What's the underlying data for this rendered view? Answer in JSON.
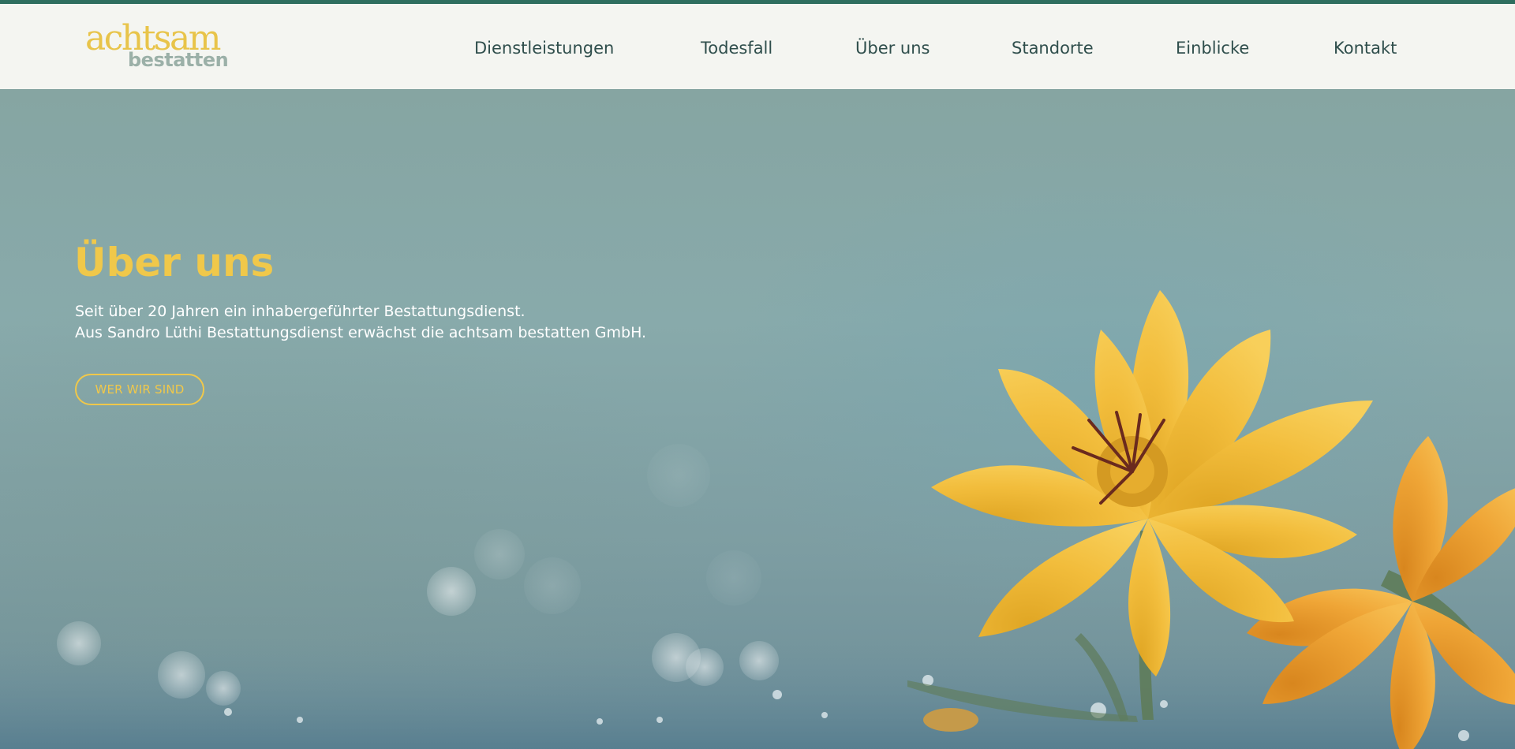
{
  "header": {
    "logo": {
      "line1": "achtsam",
      "line2": "bestatten"
    },
    "nav": [
      {
        "label": "Dienstleistungen"
      },
      {
        "label": "Todesfall"
      },
      {
        "label": "Über uns"
      },
      {
        "label": "Standorte"
      },
      {
        "label": "Einblicke"
      },
      {
        "label": "Kontakt"
      }
    ]
  },
  "hero": {
    "title": "Über uns",
    "lines": [
      "Seit über 20 Jahren ein inhabergeführter Bestattungsdienst.",
      "Aus Sandro Lüthi Bestattungsdienst erwächst die achtsam bestatten GmbH."
    ],
    "button_label": "WER WIR SIND"
  },
  "colors": {
    "accent_top_bar": "#2e6e5f",
    "header_background": "#f4f5f1",
    "logo_yellow": "#e8c44a",
    "logo_gray": "#9bb0a8",
    "nav_text": "#2f4e4c",
    "hero_accent": "#f0c84a",
    "hero_text": "#ffffff"
  },
  "icons": [
    "flower-image"
  ]
}
